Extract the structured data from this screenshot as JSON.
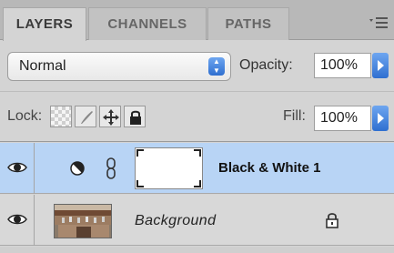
{
  "tabs": [
    {
      "label": "LAYERS",
      "active": true
    },
    {
      "label": "CHANNELS",
      "active": false
    },
    {
      "label": "PATHS",
      "active": false
    }
  ],
  "blend": {
    "mode": "Normal",
    "opacity_label": "Opacity:",
    "opacity_value": "100%"
  },
  "lock": {
    "label": "Lock:",
    "fill_label": "Fill:",
    "fill_value": "100%"
  },
  "layers": [
    {
      "name": "Black & White 1",
      "selected": true,
      "type": "adjustment",
      "visible": true
    },
    {
      "name": "Background",
      "selected": false,
      "type": "image",
      "locked": true,
      "visible": true
    }
  ],
  "colors": {
    "selection": "#b8d4f5",
    "accent": "#2f6fd0",
    "panel": "#d4d4d4"
  },
  "icons": {
    "panel_menu": "panel-menu-icon",
    "eye": "eye-icon",
    "adjustment": "black-white-adjustment-icon",
    "chain": "link-chain-icon",
    "lock": "padlock-icon"
  }
}
